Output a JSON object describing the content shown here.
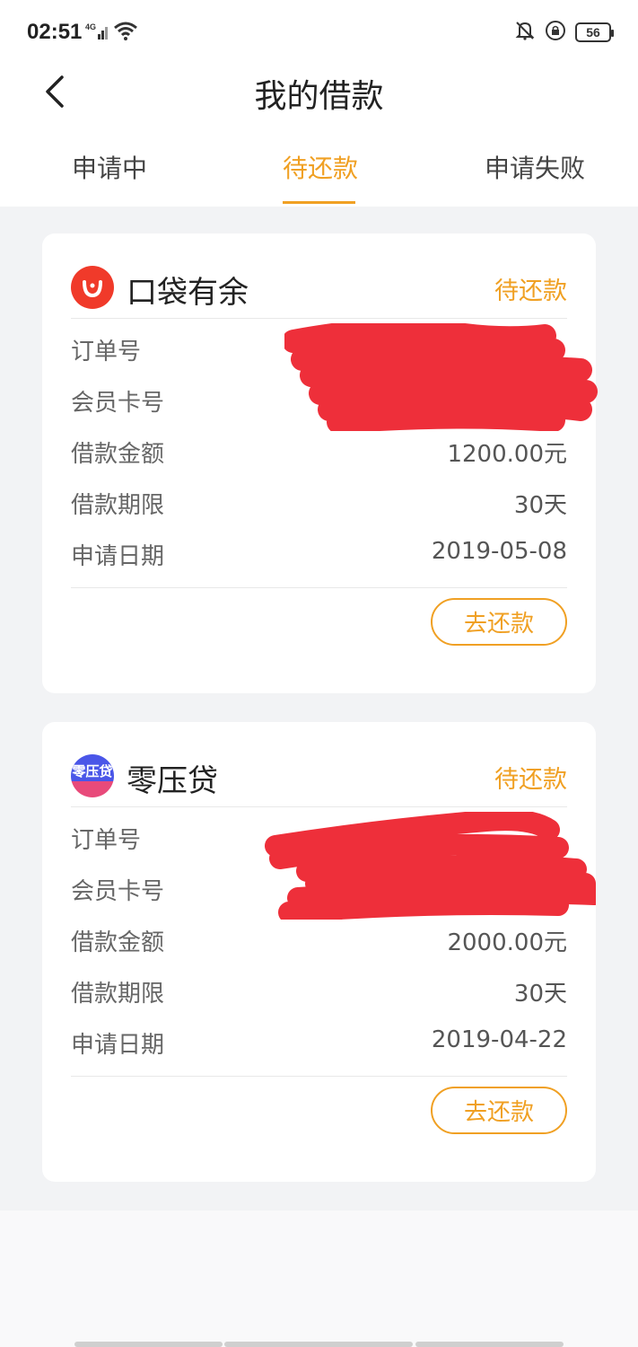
{
  "status_bar": {
    "time": "02:51",
    "network": "4G",
    "battery": "56"
  },
  "header": {
    "title": "我的借款"
  },
  "tabs": [
    {
      "label": "申请中",
      "active": false
    },
    {
      "label": "待还款",
      "active": true
    },
    {
      "label": "申请失败",
      "active": false
    }
  ],
  "loans": [
    {
      "brand": "口袋有余",
      "status": "待还款",
      "rows": [
        {
          "label": "订单号",
          "value": ""
        },
        {
          "label": "会员卡号",
          "value": ""
        },
        {
          "label": "借款金额",
          "value": "1200.00元"
        },
        {
          "label": "借款期限",
          "value": "30天"
        },
        {
          "label": "申请日期",
          "value": "2019-05-08"
        }
      ],
      "action": "去还款"
    },
    {
      "brand": "零压贷",
      "logo_text": "零压贷",
      "status": "待还款",
      "rows": [
        {
          "label": "订单号",
          "value": ""
        },
        {
          "label": "会员卡号",
          "value": ""
        },
        {
          "label": "借款金额",
          "value": "2000.00元"
        },
        {
          "label": "借款期限",
          "value": "30天"
        },
        {
          "label": "申请日期",
          "value": "2019-04-22"
        }
      ],
      "action": "去还款"
    }
  ],
  "colors": {
    "accent": "#f0a023",
    "redaction": "#ee2f3a",
    "koudai_logo": "#f03a2a"
  }
}
